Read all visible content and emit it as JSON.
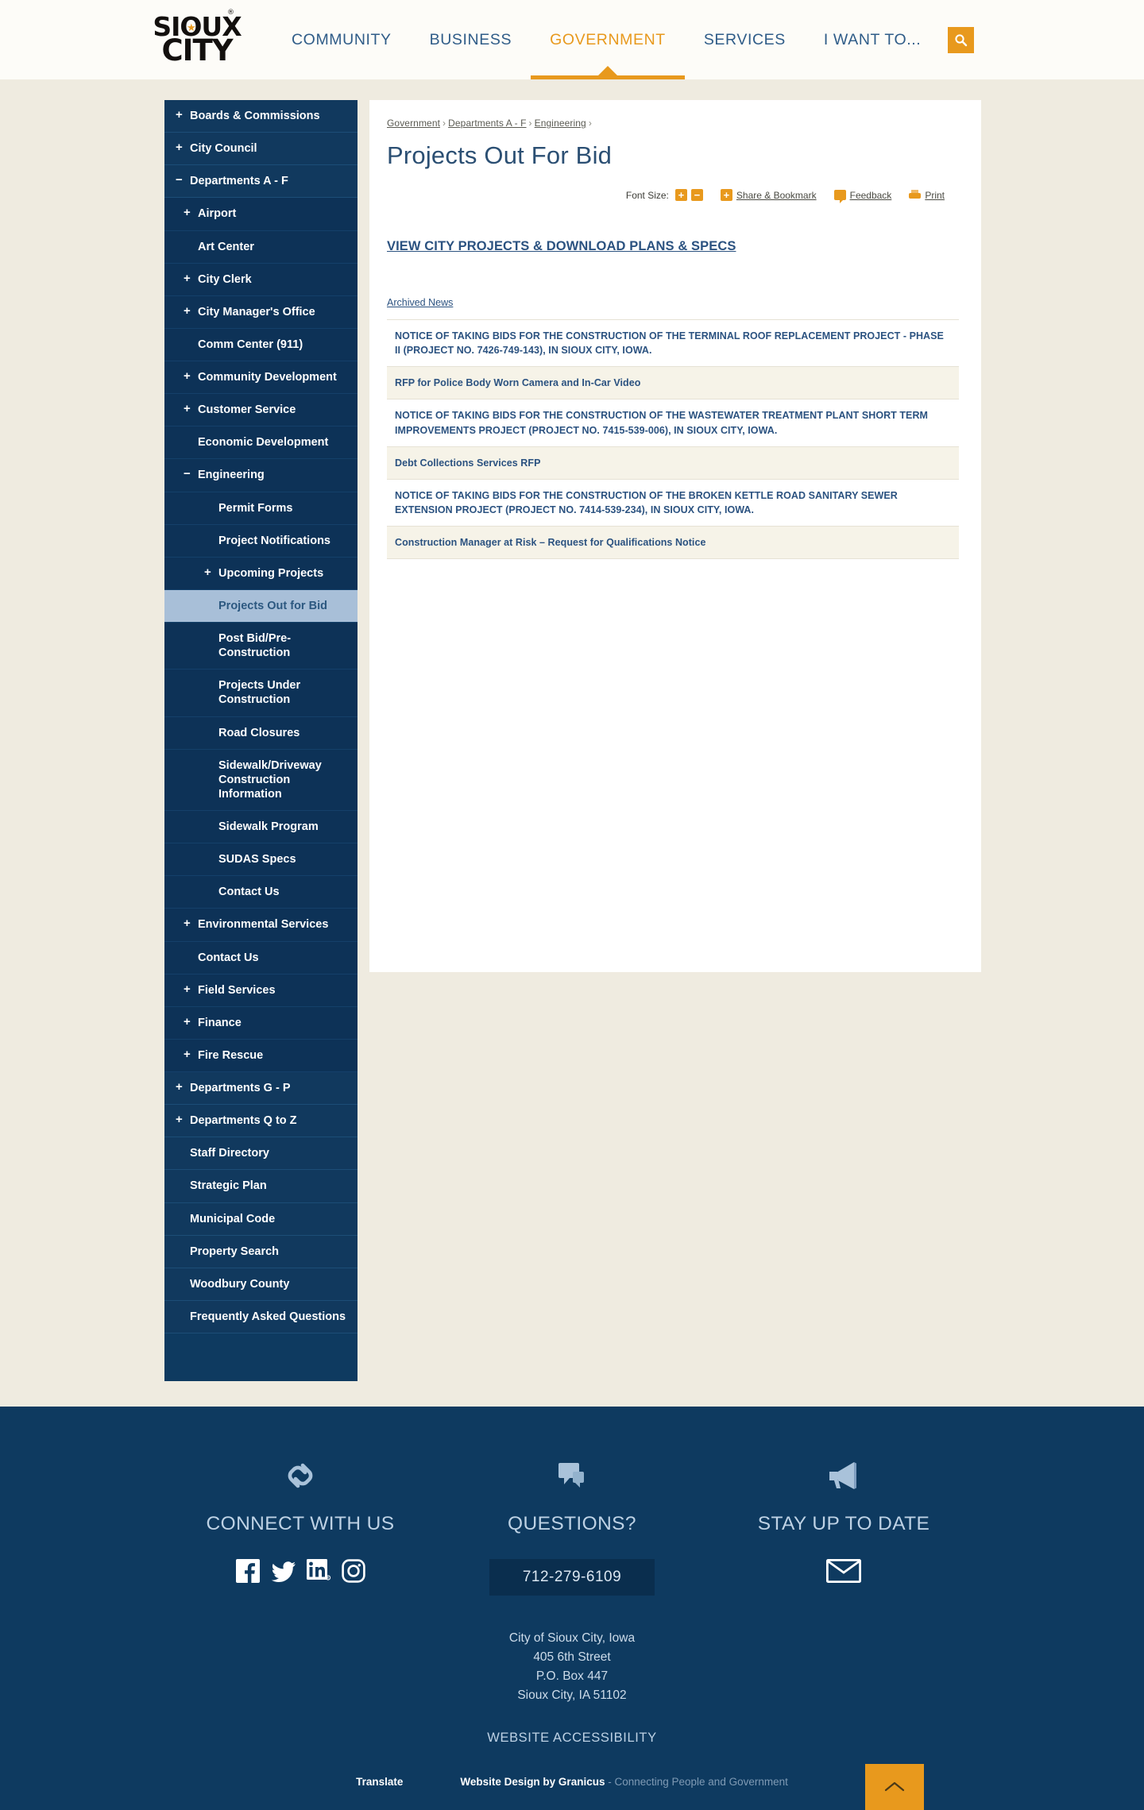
{
  "header": {
    "logo": {
      "line1": "SIOUX",
      "line2": "CITY",
      "tm": "®",
      "star": "★"
    },
    "nav": [
      {
        "label": "COMMUNITY",
        "active": false
      },
      {
        "label": "BUSINESS",
        "active": false
      },
      {
        "label": "GOVERNMENT",
        "active": true
      },
      {
        "label": "SERVICES",
        "active": false
      },
      {
        "label": "I WANT TO...",
        "active": false
      }
    ],
    "search_icon": "search-icon",
    "accent_color": "#e8991d",
    "nav_color": "#2f5c88"
  },
  "sidebar": {
    "items": [
      {
        "label": "Boards & Commissions",
        "level": 0,
        "toggle": "+",
        "active": false
      },
      {
        "label": "City Council",
        "level": 0,
        "toggle": "+",
        "active": false
      },
      {
        "label": "Departments A - F",
        "level": 0,
        "toggle": "−",
        "active": false
      },
      {
        "label": "Airport",
        "level": 1,
        "toggle": "+",
        "active": false
      },
      {
        "label": "Art Center",
        "level": 1,
        "toggle": "",
        "active": false
      },
      {
        "label": "City Clerk",
        "level": 1,
        "toggle": "+",
        "active": false
      },
      {
        "label": "City Manager's Office",
        "level": 1,
        "toggle": "+",
        "active": false
      },
      {
        "label": "Comm Center (911)",
        "level": 1,
        "toggle": "",
        "active": false
      },
      {
        "label": "Community Development",
        "level": 1,
        "toggle": "+",
        "active": false
      },
      {
        "label": "Customer Service",
        "level": 1,
        "toggle": "+",
        "active": false
      },
      {
        "label": "Economic Development",
        "level": 1,
        "toggle": "",
        "active": false
      },
      {
        "label": "Engineering",
        "level": 1,
        "toggle": "−",
        "active": false
      },
      {
        "label": "Permit Forms",
        "level": 2,
        "toggle": "",
        "active": false
      },
      {
        "label": "Project Notifications",
        "level": 2,
        "toggle": "",
        "active": false
      },
      {
        "label": "Upcoming Projects",
        "level": 2,
        "toggle": "+",
        "active": false
      },
      {
        "label": "Projects Out for Bid",
        "level": 2,
        "toggle": "",
        "active": true
      },
      {
        "label": "Post Bid/Pre-Construction",
        "level": 2,
        "toggle": "",
        "active": false
      },
      {
        "label": "Projects Under Construction",
        "level": 2,
        "toggle": "",
        "active": false
      },
      {
        "label": "Road Closures",
        "level": 2,
        "toggle": "",
        "active": false
      },
      {
        "label": "Sidewalk/Driveway Construction Information",
        "level": 2,
        "toggle": "",
        "active": false
      },
      {
        "label": "Sidewalk Program",
        "level": 2,
        "toggle": "",
        "active": false
      },
      {
        "label": "SUDAS Specs",
        "level": 2,
        "toggle": "",
        "active": false
      },
      {
        "label": "Contact Us",
        "level": 2,
        "toggle": "",
        "active": false
      },
      {
        "label": "Environmental Services",
        "level": 1,
        "toggle": "+",
        "active": false
      },
      {
        "label": "Contact Us",
        "level": 1,
        "toggle": "",
        "active": false
      },
      {
        "label": "Field Services",
        "level": 1,
        "toggle": "+",
        "active": false
      },
      {
        "label": "Finance",
        "level": 1,
        "toggle": "+",
        "active": false
      },
      {
        "label": "Fire Rescue",
        "level": 1,
        "toggle": "+",
        "active": false
      },
      {
        "label": "Departments G - P",
        "level": 0,
        "toggle": "+",
        "active": false
      },
      {
        "label": "Departments Q to Z",
        "level": 0,
        "toggle": "+",
        "active": false
      },
      {
        "label": "Staff Directory",
        "level": 0,
        "toggle": "",
        "active": false
      },
      {
        "label": "Strategic Plan",
        "level": 0,
        "toggle": "",
        "active": false
      },
      {
        "label": "Municipal Code",
        "level": 0,
        "toggle": "",
        "active": false
      },
      {
        "label": "Property Search",
        "level": 0,
        "toggle": "",
        "active": false
      },
      {
        "label": "Woodbury County",
        "level": 0,
        "toggle": "",
        "active": false
      },
      {
        "label": "Frequently Asked Questions",
        "level": 0,
        "toggle": "",
        "active": false
      }
    ]
  },
  "main": {
    "breadcrumb": [
      "Government",
      "Departments A - F",
      "Engineering"
    ],
    "breadcrumb_separator": "›",
    "title": "Projects Out For Bid",
    "tools": {
      "font_size_label": "Font Size:",
      "increase": "+",
      "decrease": "−",
      "share_icon": "+",
      "share_label": "Share & Bookmark",
      "feedback_label": "Feedback",
      "print_label": "Print"
    },
    "primary_link": "VIEW CITY PROJECTS & DOWNLOAD PLANS & SPECS",
    "archived_link": "Archived News",
    "notices": [
      "NOTICE OF TAKING BIDS FOR THE CONSTRUCTION OF THE TERMINAL ROOF REPLACEMENT PROJECT - PHASE II (PROJECT NO. 7426-749-143), IN SIOUX CITY, IOWA.",
      "RFP for Police Body Worn Camera and In-Car Video",
      "NOTICE OF TAKING BIDS FOR THE CONSTRUCTION OF THE WASTEWATER TREATMENT PLANT SHORT TERM IMPROVEMENTS PROJECT (PROJECT NO. 7415-539-006), IN SIOUX CITY, IOWA.",
      "Debt Collections Services RFP",
      "NOTICE OF TAKING BIDS FOR THE CONSTRUCTION OF THE BROKEN KETTLE ROAD SANITARY SEWER EXTENSION PROJECT (PROJECT NO. 7414-539-234), IN SIOUX CITY, IOWA.",
      "Construction Manager at Risk – Request for Qualifications Notice"
    ]
  },
  "footer": {
    "columns": [
      {
        "icon": "link-chain-icon",
        "title": "CONNECT WITH US"
      },
      {
        "icon": "speech-bubble-icon",
        "title": "QUESTIONS?"
      },
      {
        "icon": "megaphone-icon",
        "title": "STAY UP TO DATE"
      }
    ],
    "socials": [
      "facebook-icon",
      "twitter-icon",
      "linkedin-icon",
      "instagram-icon"
    ],
    "phone": "712-279-6109",
    "address": [
      "City of Sioux City, Iowa",
      "405 6th Street",
      "P.O. Box 447",
      "Sioux City, IA 51102"
    ],
    "accessibility": "WEBSITE ACCESSIBILITY",
    "translate": "Translate",
    "design_credit": "Website Design by Granicus",
    "design_tagline": " - Connecting People and Government",
    "back_to_top": "back-to-top-icon",
    "bg_color": "#0e3a60"
  }
}
